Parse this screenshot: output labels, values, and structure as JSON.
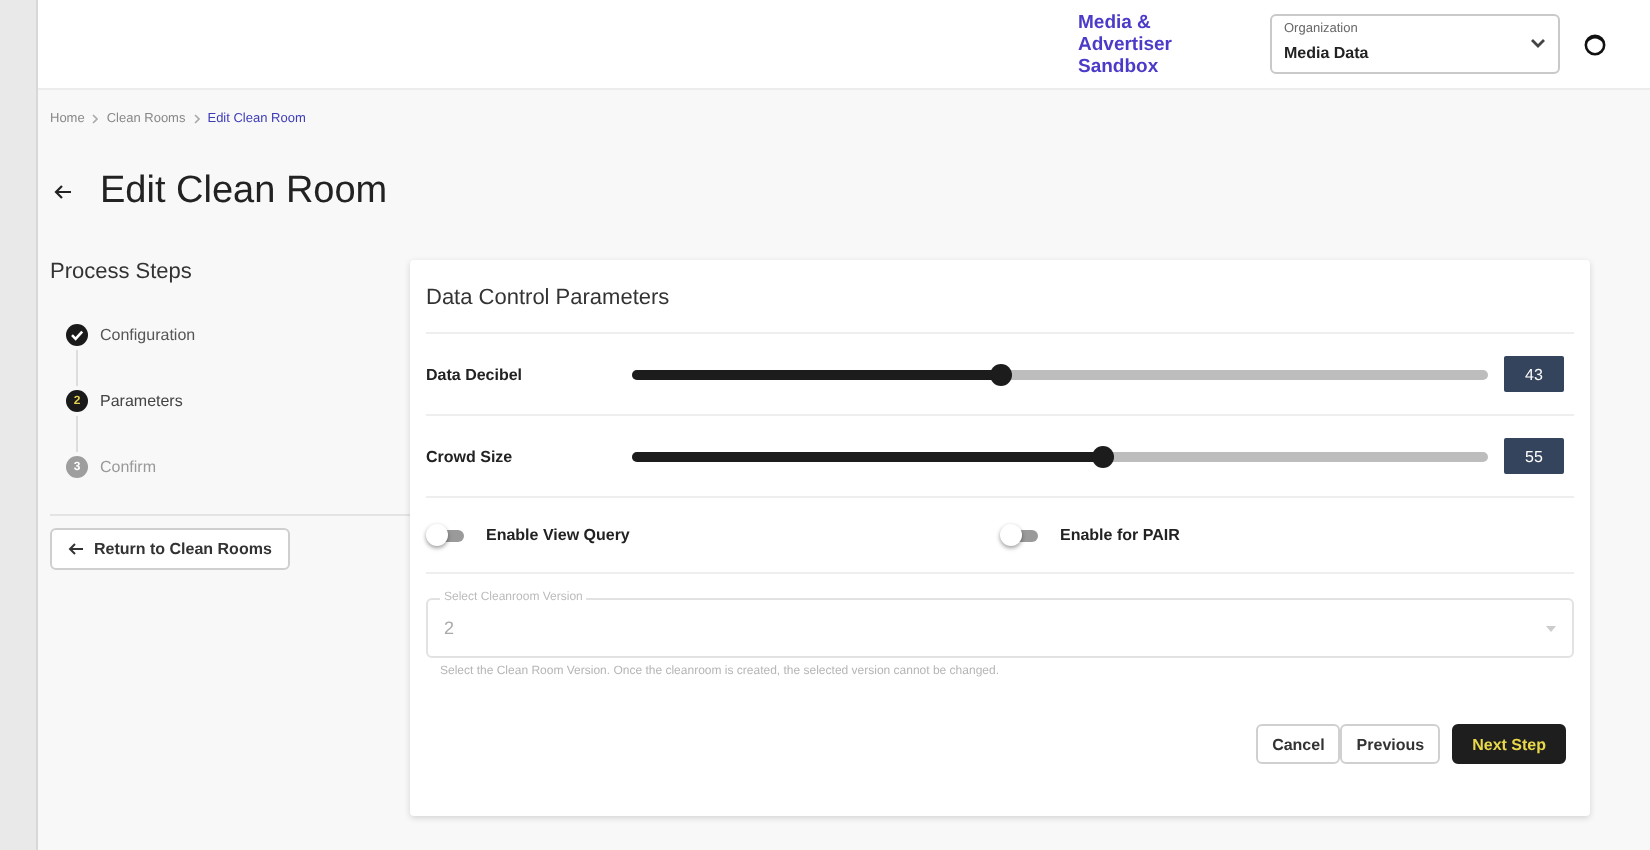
{
  "header": {
    "sandbox": "Media & Advertiser Sandbox",
    "organization": {
      "label": "Organization",
      "value": "Media Data"
    }
  },
  "breadcrumbs": [
    {
      "label": "Home",
      "current": false
    },
    {
      "label": "Clean Rooms",
      "current": false
    },
    {
      "label": "Edit Clean Room",
      "current": true
    }
  ],
  "page_title": "Edit Clean Room",
  "steps_title": "Process Steps",
  "steps": [
    {
      "label": "Configuration",
      "completed": true,
      "active": false
    },
    {
      "label": "Parameters",
      "number": "2",
      "completed": false,
      "active": true
    },
    {
      "label": "Confirm",
      "number": "3",
      "completed": false,
      "active": false
    }
  ],
  "return_button": "Return to Clean Rooms",
  "card": {
    "title": "Data Control Parameters",
    "sliders": [
      {
        "label": "Data Decibel",
        "level": 0.43,
        "value": "43"
      },
      {
        "label": "Crowd Size",
        "level": 0.55,
        "value": "55"
      }
    ],
    "toggles": [
      {
        "label": "Enable View Query",
        "on": false
      },
      {
        "label": "Enable for PAIR",
        "on": false
      }
    ],
    "version": {
      "label": "Select Cleanroom Version",
      "value": "2",
      "disabled": true,
      "helper": "Select the Clean Room Version. Once the cleanroom is created, the selected version cannot be changed."
    },
    "buttons": [
      {
        "label": "Cancel",
        "kind": "outline"
      },
      {
        "label": "Previous",
        "kind": "outline"
      },
      {
        "label": "Next Step",
        "kind": "primary"
      }
    ]
  }
}
